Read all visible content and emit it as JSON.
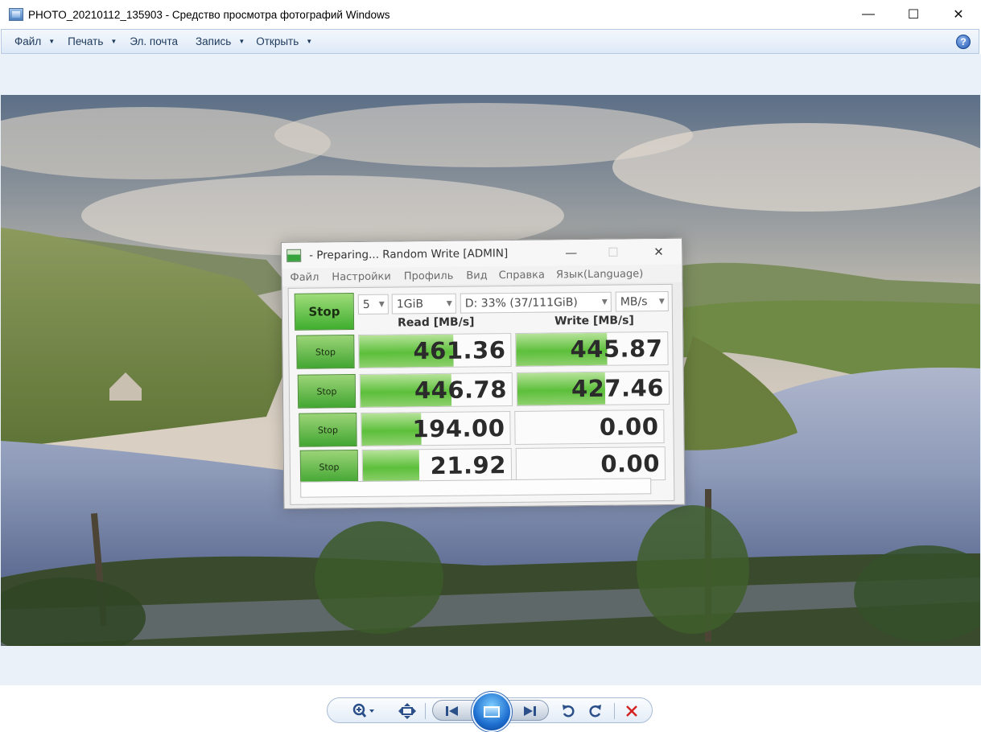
{
  "window": {
    "title": "PHOTO_20210112_135903 - Средство просмотра фотографий Windows",
    "minimize_glyph": "—",
    "maximize_glyph": "☐",
    "close_glyph": "✕"
  },
  "menu": {
    "items": [
      {
        "label": "Файл",
        "has_dropdown": true
      },
      {
        "label": "Печать",
        "has_dropdown": true
      },
      {
        "label": "Эл. почта",
        "has_dropdown": false
      },
      {
        "label": "Запись",
        "has_dropdown": true
      },
      {
        "label": "Открыть",
        "has_dropdown": true
      }
    ],
    "help_glyph": "?"
  },
  "photo": {
    "cdm_window": {
      "title": "- Preparing... Random Write [ADMIN]",
      "menu": [
        "Файл",
        "Настройки",
        "Профиль",
        "Вид",
        "Справка",
        "Язык(Language)"
      ],
      "main_button": "Stop",
      "test_count": "5",
      "test_size": "1GiB",
      "drive": "D: 33% (37/111GiB)",
      "unit": "MB/s",
      "read_header": "Read [MB/s]",
      "write_header": "Write [MB/s]",
      "rows": [
        {
          "button": "Stop",
          "read": "461.36",
          "write": "445.87",
          "read_fill": 0.62,
          "write_fill": 0.6
        },
        {
          "button": "Stop",
          "read": "446.78",
          "write": "427.46",
          "read_fill": 0.6,
          "write_fill": 0.58
        },
        {
          "button": "Stop",
          "read": "194.00",
          "write": "0.00",
          "read_fill": 0.4,
          "write_fill": 0
        },
        {
          "button": "Stop",
          "read": "21.92",
          "write": "0.00",
          "read_fill": 0.38,
          "write_fill": 0
        }
      ]
    }
  },
  "toolbar": {
    "icons": [
      "zoom-icon",
      "fit-icon",
      "previous-icon",
      "slideshow-icon",
      "next-icon",
      "rotate-left-icon",
      "rotate-right-icon",
      "delete-icon"
    ],
    "accent_color": "#2a4f89",
    "delete_color": "#d42323"
  }
}
